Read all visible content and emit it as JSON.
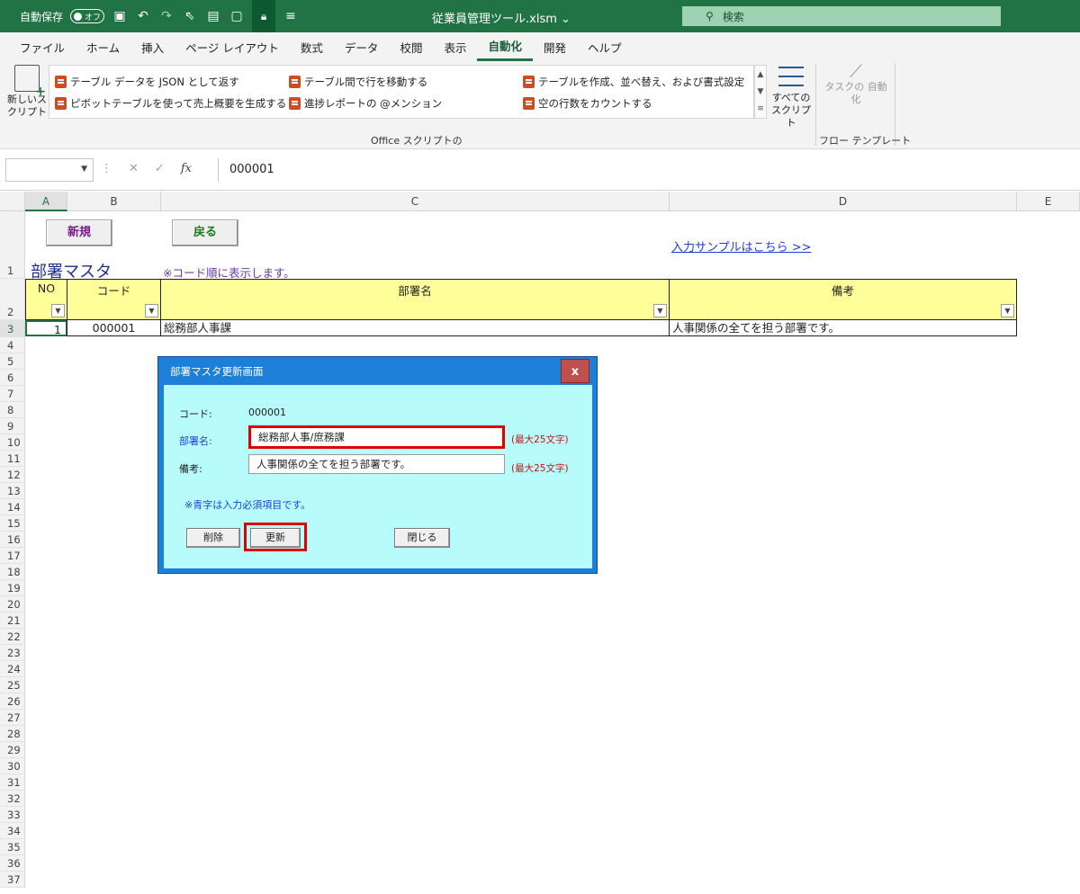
{
  "titlebar": {
    "autosave_label": "自動保存",
    "autosave_state": "オフ",
    "document_title": "従業員管理ツール.xlsm",
    "search_placeholder": "検索"
  },
  "menu": {
    "tabs": [
      "ファイル",
      "ホーム",
      "挿入",
      "ページ レイアウト",
      "数式",
      "データ",
      "校閲",
      "表示",
      "自動化",
      "開発",
      "ヘルプ"
    ],
    "active_tab": "自動化"
  },
  "ribbon": {
    "new_script": "新しいス クリプト",
    "scripts": [
      "テーブル データを JSON として返す",
      "ピボットテーブルを使って売上概要を生成する",
      "テーブル間で行を移動する",
      "進捗レポートの @メンション",
      "テーブルを作成、並べ替え、および書式設定",
      "空の行数をカウントする"
    ],
    "all_scripts": "すべての スクリプト",
    "task_automation": "タスクの 自動化",
    "group_office_scripts": "Office スクリプトの",
    "group_flow_templates": "フロー テンプレート"
  },
  "formula": {
    "value": "000001"
  },
  "sheet": {
    "columns": [
      "A",
      "B",
      "C",
      "D",
      "E"
    ],
    "selected_column": "A",
    "rows": [
      "1",
      "2",
      "3",
      "4",
      "5",
      "6",
      "7",
      "8",
      "9",
      "10",
      "11",
      "12",
      "13",
      "14",
      "15",
      "16",
      "17",
      "18",
      "19",
      "20",
      "21",
      "22",
      "23",
      "24",
      "25",
      "26",
      "27",
      "28",
      "29",
      "30",
      "31",
      "32",
      "33",
      "34",
      "35",
      "36",
      "37"
    ],
    "selected_row": "3",
    "btn_new": "新規",
    "btn_back": "戻る",
    "sample_link": "入力サンプルはこちら >>",
    "title": "部署マスタ",
    "note": "※コード順に表示します。",
    "headers": [
      "NO",
      "コード",
      "部署名",
      "備考"
    ],
    "data_row": [
      "1",
      "000001",
      "総務部人事課",
      "人事関係の全てを担う部署です。"
    ]
  },
  "dialog": {
    "title": "部署マスタ更新画面",
    "close": "x",
    "code_label": "コード:",
    "code_value": "000001",
    "name_label": "部署名:",
    "name_value": "総務部人事/庶務課",
    "name_max": "(最大25文字)",
    "remarks_label": "備考:",
    "remarks_value": "人事関係の全てを担う部署です。",
    "remarks_max": "(最大25文字)",
    "required_note": "※青字は入力必須項目です。",
    "btn_delete": "削除",
    "btn_update": "更新",
    "btn_close": "閉じる"
  },
  "colors": {
    "excel_green": "#217346",
    "header_yellow": "#ffff99",
    "dialog_blue": "#1e7fd8",
    "dialog_body": "#b8fbfb",
    "highlight_red": "#e00000"
  }
}
